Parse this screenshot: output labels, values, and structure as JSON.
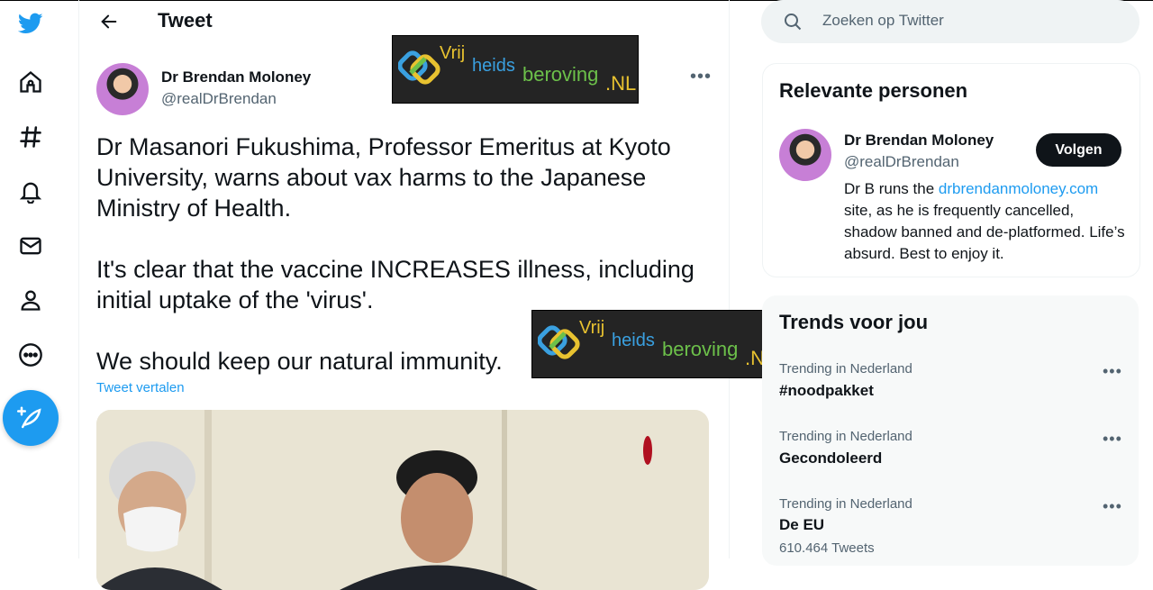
{
  "header": {
    "title": "Tweet"
  },
  "tweet": {
    "author_name": "Dr Brendan Moloney",
    "author_handle": "@realDrBrendan",
    "paragraph1": "Dr Masanori Fukushima, Professor Emeritus at Kyoto University, warns about vax harms to the Japanese Ministry of Health.",
    "paragraph2": "It's clear that the vaccine INCREASES illness, including initial uptake of the 'virus'.",
    "paragraph3": "We should keep our natural immunity.",
    "translate_label": "Tweet vertalen",
    "more_label": "•••"
  },
  "watermark": {
    "text_vrij": "Vrij",
    "text_heids": "heids",
    "text_beroving": "beroving",
    "text_nl": ".NL"
  },
  "search": {
    "placeholder": "Zoeken op Twitter"
  },
  "relevant": {
    "title": "Relevante personen",
    "name": "Dr Brendan Moloney",
    "handle": "@realDrBrendan",
    "follow_label": "Volgen",
    "bio_before": "Dr B runs the ",
    "bio_link": "drbrendanmoloney.com",
    "bio_after": " site, as he is frequently cancelled, shadow banned and de-platformed. Life’s absurd. Best to enjoy it."
  },
  "trends": {
    "title": "Trends voor jou",
    "items": [
      {
        "meta": "Trending in Nederland",
        "name": "#noodpakket",
        "count": ""
      },
      {
        "meta": "Trending in Nederland",
        "name": "Gecondoleerd",
        "count": ""
      },
      {
        "meta": "Trending in Nederland",
        "name": "De EU",
        "count": "610.464 Tweets"
      }
    ],
    "more_label": "•••"
  },
  "nav": {
    "items": [
      "twitter-logo",
      "home-icon",
      "explore-icon",
      "notifications-icon",
      "messages-icon",
      "profile-icon",
      "more-icon",
      "compose-icon"
    ]
  },
  "colors": {
    "accent": "#1d9bf0",
    "text": "#0f1419",
    "secondary": "#536471",
    "follow_bg": "#0f1419"
  }
}
